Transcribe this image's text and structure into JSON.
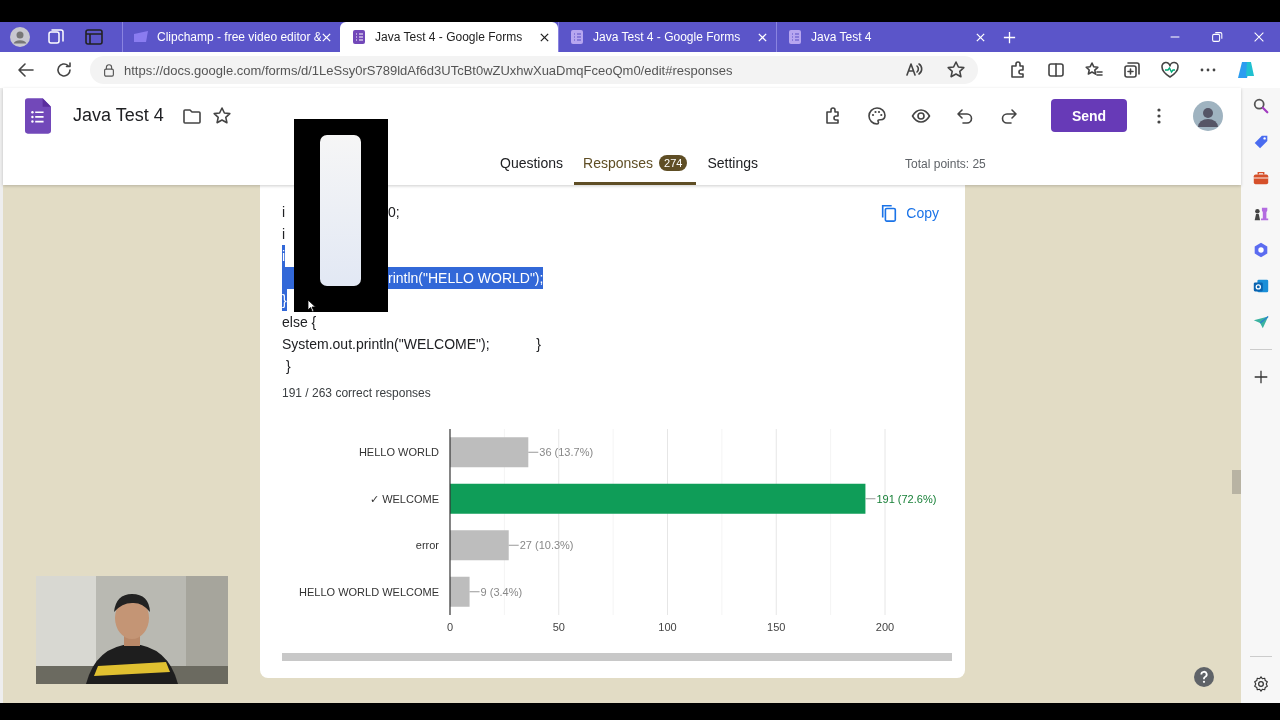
{
  "browser": {
    "tabs": [
      {
        "title": "Clipchamp - free video editor &",
        "kind": "clip",
        "selected": false
      },
      {
        "title": "Java Test 4 - Google Forms",
        "kind": "forms",
        "selected": true
      },
      {
        "title": "Java Test 4 - Google Forms",
        "kind": "forms",
        "selected": false
      },
      {
        "title": "Java Test 4",
        "kind": "forms",
        "selected": false
      }
    ],
    "address": "https://docs.google.com/forms/d/1LeSsy0rS789ldAf6d3UTcBt0wZUxhwXuaDmqFceoQm0/edit#responses"
  },
  "form": {
    "title": "Java Test 4",
    "send": "Send",
    "tabs": [
      {
        "label": "Questions",
        "selected": false
      },
      {
        "label": "Responses",
        "badge": "274",
        "selected": true
      },
      {
        "label": "Settings",
        "selected": false
      }
    ],
    "total_points": "Total points: 25"
  },
  "question": {
    "copy": "Copy",
    "code_lines": [
      {
        "text": "i",
        "tail": "0;",
        "selected": false
      },
      {
        "text": "i",
        "selected": false
      },
      {
        "text": "i",
        "selected": true
      },
      {
        "tail": "rintln(\"HELLO WORLD\");",
        "selected": true
      },
      {
        "text": "}",
        "selected": true
      },
      {
        "text": "else {",
        "selected": false
      },
      {
        "text": "System.out.println(\"WELCOME\");            }",
        "selected": false
      },
      {
        "text": " }",
        "selected": false
      }
    ],
    "summary": "191 / 263 correct responses",
    "chart_data": {
      "type": "bar",
      "orientation": "horizontal",
      "stacked": true,
      "categories": [
        "HELLO WORLD",
        "✓ WELCOME",
        "error",
        "HELLO WORLD WELCOME"
      ],
      "series": [
        {
          "color": "#bdbdbd",
          "values": [
            36,
            null,
            27,
            9
          ]
        },
        {
          "color": "#0f9d58",
          "values": [
            null,
            191,
            null,
            null
          ]
        }
      ],
      "grid": true,
      "xlim": [
        0,
        200
      ],
      "xticks": [
        0,
        50,
        100,
        150,
        200
      ],
      "value_labels": [
        "36 (13.7%)",
        "191 (72.6%)",
        "27 (10.3%)",
        "9 (3.4%)"
      ]
    }
  }
}
